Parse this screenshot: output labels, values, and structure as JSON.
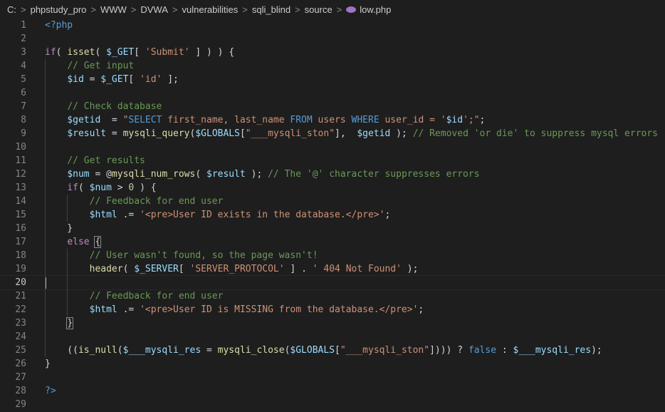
{
  "breadcrumb": {
    "items": [
      "C:",
      "phpstudy_pro",
      "WWW",
      "DVWA",
      "vulnerabilities",
      "sqli_blind",
      "source"
    ],
    "file": "low.php",
    "file_icon": "php-elephant-icon",
    "separator": ">"
  },
  "editor": {
    "current_line": 20,
    "lines": [
      {
        "n": "1",
        "tokens": [
          {
            "t": "<?php",
            "c": "k"
          }
        ]
      },
      {
        "n": "2",
        "tokens": []
      },
      {
        "n": "3",
        "tokens": [
          {
            "t": "if",
            "c": "c"
          },
          {
            "t": "( ",
            "c": "p"
          },
          {
            "t": "isset",
            "c": "f"
          },
          {
            "t": "( ",
            "c": "p"
          },
          {
            "t": "$_GET",
            "c": "v"
          },
          {
            "t": "[ ",
            "c": "p"
          },
          {
            "t": "'Submit'",
            "c": "s"
          },
          {
            "t": " ] ) ) {",
            "c": "p"
          }
        ]
      },
      {
        "n": "4",
        "tokens": [
          {
            "t": "    ",
            "c": "p"
          },
          {
            "t": "// Get input",
            "c": "m"
          }
        ]
      },
      {
        "n": "5",
        "tokens": [
          {
            "t": "    ",
            "c": "p"
          },
          {
            "t": "$id",
            "c": "v"
          },
          {
            "t": " = ",
            "c": "p"
          },
          {
            "t": "$_GET",
            "c": "v"
          },
          {
            "t": "[ ",
            "c": "p"
          },
          {
            "t": "'id'",
            "c": "s"
          },
          {
            "t": " ];",
            "c": "p"
          }
        ]
      },
      {
        "n": "6",
        "tokens": []
      },
      {
        "n": "7",
        "tokens": [
          {
            "t": "    ",
            "c": "p"
          },
          {
            "t": "// Check database",
            "c": "m"
          }
        ]
      },
      {
        "n": "8",
        "tokens": [
          {
            "t": "    ",
            "c": "p"
          },
          {
            "t": "$getid",
            "c": "v"
          },
          {
            "t": "  = ",
            "c": "p"
          },
          {
            "t": "\"",
            "c": "s"
          },
          {
            "t": "SELECT",
            "c": "k"
          },
          {
            "t": " first_name, last_name ",
            "c": "s"
          },
          {
            "t": "FROM",
            "c": "k"
          },
          {
            "t": " users ",
            "c": "s"
          },
          {
            "t": "WHERE",
            "c": "k"
          },
          {
            "t": " user_id = '",
            "c": "s"
          },
          {
            "t": "$id",
            "c": "v"
          },
          {
            "t": "';\"",
            "c": "s"
          },
          {
            "t": ";",
            "c": "p"
          }
        ]
      },
      {
        "n": "9",
        "tokens": [
          {
            "t": "    ",
            "c": "p"
          },
          {
            "t": "$result",
            "c": "v"
          },
          {
            "t": " = ",
            "c": "p"
          },
          {
            "t": "mysqli_query",
            "c": "f"
          },
          {
            "t": "(",
            "c": "p"
          },
          {
            "t": "$GLOBALS",
            "c": "v"
          },
          {
            "t": "[",
            "c": "p"
          },
          {
            "t": "\"___mysqli_ston\"",
            "c": "s"
          },
          {
            "t": "],  ",
            "c": "p"
          },
          {
            "t": "$getid",
            "c": "v"
          },
          {
            "t": " ); ",
            "c": "p"
          },
          {
            "t": "// Removed 'or die' to suppress mysql errors",
            "c": "m"
          }
        ]
      },
      {
        "n": "10",
        "tokens": []
      },
      {
        "n": "11",
        "tokens": [
          {
            "t": "    ",
            "c": "p"
          },
          {
            "t": "// Get results",
            "c": "m"
          }
        ]
      },
      {
        "n": "12",
        "tokens": [
          {
            "t": "    ",
            "c": "p"
          },
          {
            "t": "$num",
            "c": "v"
          },
          {
            "t": " = @",
            "c": "p"
          },
          {
            "t": "mysqli_num_rows",
            "c": "f"
          },
          {
            "t": "( ",
            "c": "p"
          },
          {
            "t": "$result",
            "c": "v"
          },
          {
            "t": " ); ",
            "c": "p"
          },
          {
            "t": "// The '@' character suppresses errors",
            "c": "m"
          }
        ]
      },
      {
        "n": "13",
        "tokens": [
          {
            "t": "    ",
            "c": "p"
          },
          {
            "t": "if",
            "c": "c"
          },
          {
            "t": "( ",
            "c": "p"
          },
          {
            "t": "$num",
            "c": "v"
          },
          {
            "t": " > ",
            "c": "p"
          },
          {
            "t": "0",
            "c": "n"
          },
          {
            "t": " ) {",
            "c": "p"
          }
        ]
      },
      {
        "n": "14",
        "tokens": [
          {
            "t": "        ",
            "c": "p"
          },
          {
            "t": "// Feedback for end user",
            "c": "m"
          }
        ]
      },
      {
        "n": "15",
        "tokens": [
          {
            "t": "        ",
            "c": "p"
          },
          {
            "t": "$html",
            "c": "v"
          },
          {
            "t": " .= ",
            "c": "p"
          },
          {
            "t": "'<pre>User ID exists in the database.</pre>'",
            "c": "s"
          },
          {
            "t": ";",
            "c": "p"
          }
        ]
      },
      {
        "n": "16",
        "tokens": [
          {
            "t": "    }",
            "c": "p"
          }
        ]
      },
      {
        "n": "17",
        "tokens": [
          {
            "t": "    ",
            "c": "p"
          },
          {
            "t": "else",
            "c": "c"
          },
          {
            "t": " ",
            "c": "p"
          },
          {
            "t": "{",
            "c": "p",
            "b": true
          }
        ]
      },
      {
        "n": "18",
        "tokens": [
          {
            "t": "        ",
            "c": "p"
          },
          {
            "t": "// User wasn't found, so the page wasn't!",
            "c": "m"
          }
        ]
      },
      {
        "n": "19",
        "tokens": [
          {
            "t": "        ",
            "c": "p"
          },
          {
            "t": "header",
            "c": "f"
          },
          {
            "t": "( ",
            "c": "p"
          },
          {
            "t": "$_SERVER",
            "c": "v"
          },
          {
            "t": "[ ",
            "c": "p"
          },
          {
            "t": "'SERVER_PROTOCOL'",
            "c": "s"
          },
          {
            "t": " ] . ",
            "c": "p"
          },
          {
            "t": "' 404 Not Found'",
            "c": "s"
          },
          {
            "t": " );",
            "c": "p"
          }
        ]
      },
      {
        "n": "20",
        "tokens": []
      },
      {
        "n": "21",
        "tokens": [
          {
            "t": "        ",
            "c": "p"
          },
          {
            "t": "// Feedback for end user",
            "c": "m"
          }
        ]
      },
      {
        "n": "22",
        "tokens": [
          {
            "t": "        ",
            "c": "p"
          },
          {
            "t": "$html",
            "c": "v"
          },
          {
            "t": " .= ",
            "c": "p"
          },
          {
            "t": "'<pre>User ID is MISSING from the database.</pre>'",
            "c": "s"
          },
          {
            "t": ";",
            "c": "p"
          }
        ]
      },
      {
        "n": "23",
        "tokens": [
          {
            "t": "    ",
            "c": "p"
          },
          {
            "t": "}",
            "c": "p",
            "b": true
          }
        ]
      },
      {
        "n": "24",
        "tokens": []
      },
      {
        "n": "25",
        "tokens": [
          {
            "t": "    ((",
            "c": "p"
          },
          {
            "t": "is_null",
            "c": "f"
          },
          {
            "t": "(",
            "c": "p"
          },
          {
            "t": "$___mysqli_res",
            "c": "v"
          },
          {
            "t": " = ",
            "c": "p"
          },
          {
            "t": "mysqli_close",
            "c": "f"
          },
          {
            "t": "(",
            "c": "p"
          },
          {
            "t": "$GLOBALS",
            "c": "v"
          },
          {
            "t": "[",
            "c": "p"
          },
          {
            "t": "\"___mysqli_ston\"",
            "c": "s"
          },
          {
            "t": "]))) ? ",
            "c": "p"
          },
          {
            "t": "false",
            "c": "k"
          },
          {
            "t": " : ",
            "c": "p"
          },
          {
            "t": "$___mysqli_res",
            "c": "v"
          },
          {
            "t": ");",
            "c": "p"
          }
        ]
      },
      {
        "n": "26",
        "tokens": [
          {
            "t": "}",
            "c": "p"
          }
        ]
      },
      {
        "n": "27",
        "tokens": []
      },
      {
        "n": "28",
        "tokens": [
          {
            "t": "?>",
            "c": "k"
          }
        ]
      },
      {
        "n": "29",
        "tokens": []
      }
    ]
  }
}
